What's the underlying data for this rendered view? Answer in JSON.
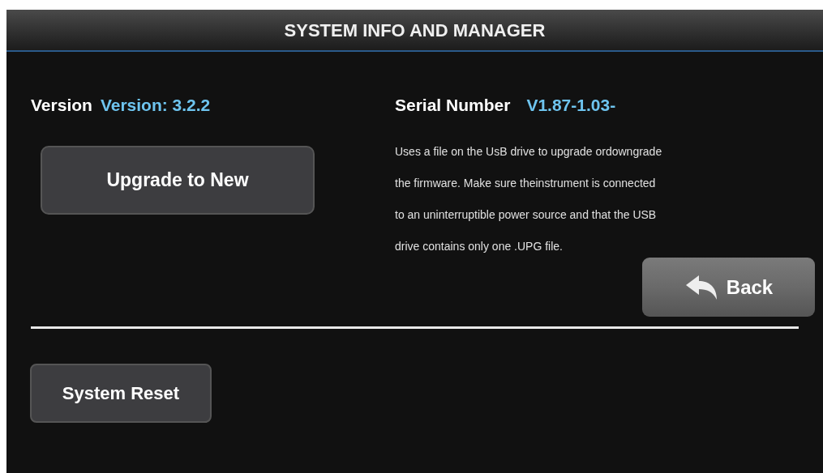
{
  "header": {
    "title": "SYSTEM INFO AND MANAGER"
  },
  "version": {
    "label": "Version",
    "value": "Version: 3.2.2"
  },
  "serial": {
    "label": "Serial Number",
    "value": "V1.87-1.03-"
  },
  "upgrade_button": "Upgrade to New",
  "description_lines": [
    "Uses a file on the UsB drive to upgrade ordowngrade",
    "the firmware. Make sure theinstrument is connected",
    "to an uninterruptible power source and that the USB",
    "drive contains only one .UPG file."
  ],
  "back_button": "Back",
  "reset_button": "System Reset"
}
